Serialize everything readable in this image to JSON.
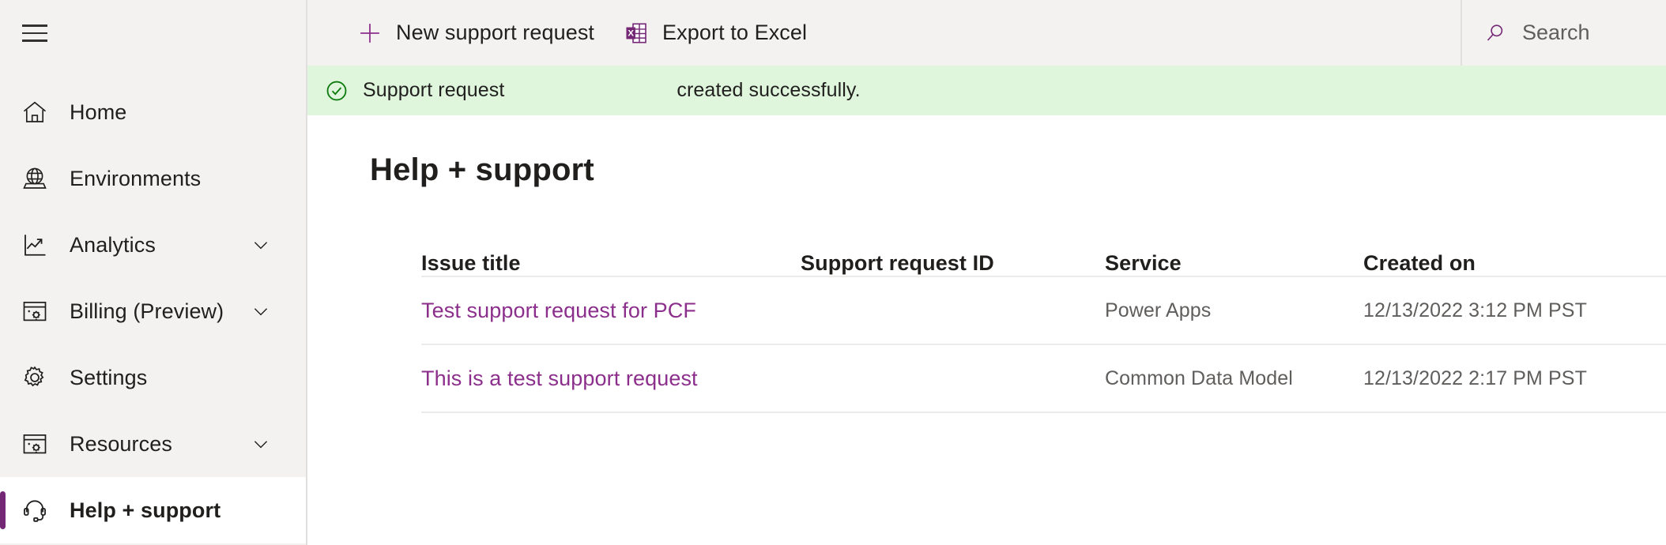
{
  "sidebar": {
    "menu_icon": "hamburger-icon",
    "items": [
      {
        "label": "Home",
        "icon": "home-icon",
        "expandable": false,
        "selected": false
      },
      {
        "label": "Environments",
        "icon": "globe-icon",
        "expandable": false,
        "selected": false
      },
      {
        "label": "Analytics",
        "icon": "chart-line-icon",
        "expandable": true,
        "selected": false
      },
      {
        "label": "Billing (Preview)",
        "icon": "billing-icon",
        "expandable": true,
        "selected": false
      },
      {
        "label": "Settings",
        "icon": "gear-icon",
        "expandable": false,
        "selected": false
      },
      {
        "label": "Resources",
        "icon": "resources-icon",
        "expandable": true,
        "selected": false
      },
      {
        "label": "Help + support",
        "icon": "headset-icon",
        "expandable": false,
        "selected": true
      }
    ]
  },
  "toolbar": {
    "commands": [
      {
        "label": "New support request",
        "icon": "plus-icon"
      },
      {
        "label": "Export to Excel",
        "icon": "excel-icon"
      }
    ],
    "search": {
      "icon": "search-icon",
      "placeholder": "Search",
      "value": ""
    }
  },
  "notification": {
    "icon": "check-circle-icon",
    "prefix": "Support request",
    "request_id": "",
    "suffix": "created successfully."
  },
  "page": {
    "title": "Help + support"
  },
  "table": {
    "columns": [
      {
        "key": "title",
        "label": "Issue title"
      },
      {
        "key": "request_id",
        "label": "Support request ID"
      },
      {
        "key": "service",
        "label": "Service"
      },
      {
        "key": "created_on",
        "label": "Created on"
      }
    ],
    "rows": [
      {
        "title": "Test support request for PCF",
        "request_id": "",
        "service": "Power Apps",
        "created_on": "12/13/2022 3:12 PM PST"
      },
      {
        "title": "This is a test support request",
        "request_id": "",
        "service": "Common Data Model",
        "created_on": "12/13/2022 2:17 PM PST"
      }
    ]
  },
  "colors": {
    "accent": "#742774",
    "link": "#8c2f8c",
    "sidebar_bg": "#f3f2f1",
    "success_bg": "#dff6dd",
    "success_icon": "#107c10",
    "text": "#201f1e",
    "muted_text": "#605e5c"
  }
}
